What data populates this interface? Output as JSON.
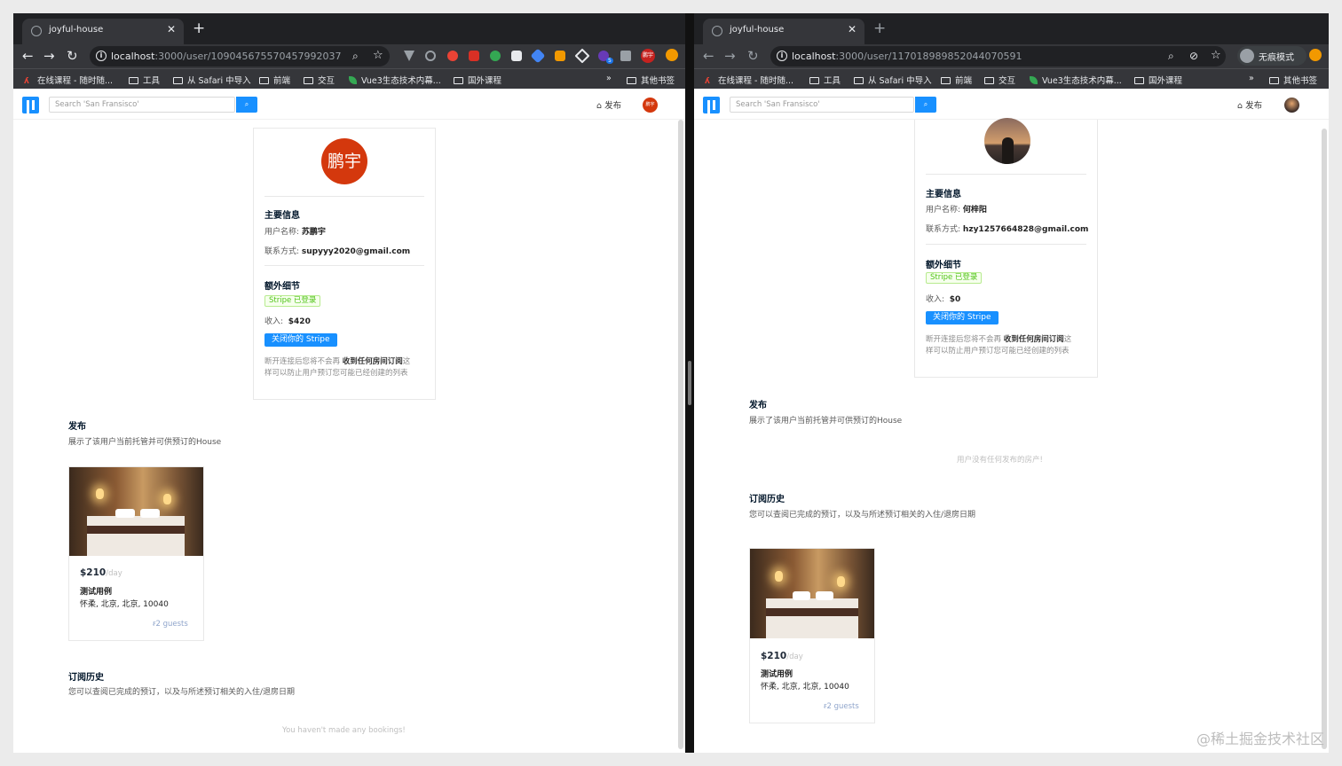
{
  "left": {
    "tab_title": "joyful-house",
    "url_host": "localhost",
    "url_path": ":3000/user/109045675570457992037",
    "bookmarks": [
      "在线课程 - 随时随...",
      "工具",
      "从 Safari 中导入",
      "前端",
      "交互",
      "Vue3生态技术内幕...",
      "国外课程",
      "»",
      "其他书签"
    ],
    "ext_badge": "5",
    "ext_avatar": "鹏宇",
    "search_placeholder": "Search 'San Fransisco'",
    "publish_label": "发布",
    "avatar_text": "鹏宇",
    "main_info_title": "主要信息",
    "username_label": "用户名称:",
    "username": "苏鹏宇",
    "contact_label": "联系方式:",
    "contact": "supyyy2020@gmail.com",
    "extra_title": "额外细节",
    "stripe_tag": "Stripe 已登录",
    "income_label": "收入:",
    "income": "$420",
    "close_stripe": "关闭你的 Stripe",
    "disconnect_pre": "断开连接后您将不会再 ",
    "disconnect_bold": "收到任何房间订阅",
    "disconnect_post": "这",
    "disconnect_line2": "样可以防止用户预订您可能已经创建的列表",
    "listings_title": "发布",
    "listings_desc": "展示了该用户当前托管并可供预订的House",
    "listing_price": "$210",
    "listing_unit": "/day",
    "listing_title": "测试用例",
    "listing_addr": "怀柔, 北京, 北京, 10040",
    "listing_guests": "2 guests",
    "bookings_title": "订阅历史",
    "bookings_desc": "您可以查阅已完成的预订，以及与所述预订相关的入住/退房日期",
    "no_bookings": "You haven't made any bookings!"
  },
  "right": {
    "tab_title": "joyful-house",
    "url_host": "localhost",
    "url_path": ":3000/user/117018989852044070591",
    "incognito_label": "无痕模式",
    "bookmarks": [
      "在线课程 - 随时随...",
      "工具",
      "从 Safari 中导入",
      "前端",
      "交互",
      "Vue3生态技术内幕...",
      "国外课程",
      "»",
      "其他书签"
    ],
    "search_placeholder": "Search 'San Fransisco'",
    "publish_label": "发布",
    "main_info_title": "主要信息",
    "username_label": "用户名称:",
    "username": "何梓阳",
    "contact_label": "联系方式:",
    "contact": "hzy1257664828@gmail.com",
    "extra_title": "额外细节",
    "stripe_tag": "Stripe 已登录",
    "income_label": "收入:",
    "income": "$0",
    "close_stripe": "关闭你的 Stripe",
    "disconnect_pre": "断开连接后您将不会再 ",
    "disconnect_bold": "收到任何房间订阅",
    "disconnect_post": "这",
    "disconnect_line2": "样可以防止用户预订您可能已经创建的列表",
    "listings_title": "发布",
    "listings_desc": "展示了该用户当前托管并可供预订的House",
    "no_listings": "用户没有任何发布的房产!",
    "bookings_title": "订阅历史",
    "bookings_desc": "您可以查阅已完成的预订，以及与所述预订相关的入住/退房日期",
    "booking_price": "$210",
    "booking_unit": "/day",
    "booking_title": "测试用例",
    "booking_addr": "怀柔, 北京, 北京, 10040",
    "booking_guests": "2 guests"
  },
  "watermark": "@稀土掘金技术社区",
  "colors": {
    "primary": "#1890ff",
    "success": "#52c41a",
    "chrome_dark": "#35363a",
    "avatar_red": "#d4380d"
  }
}
